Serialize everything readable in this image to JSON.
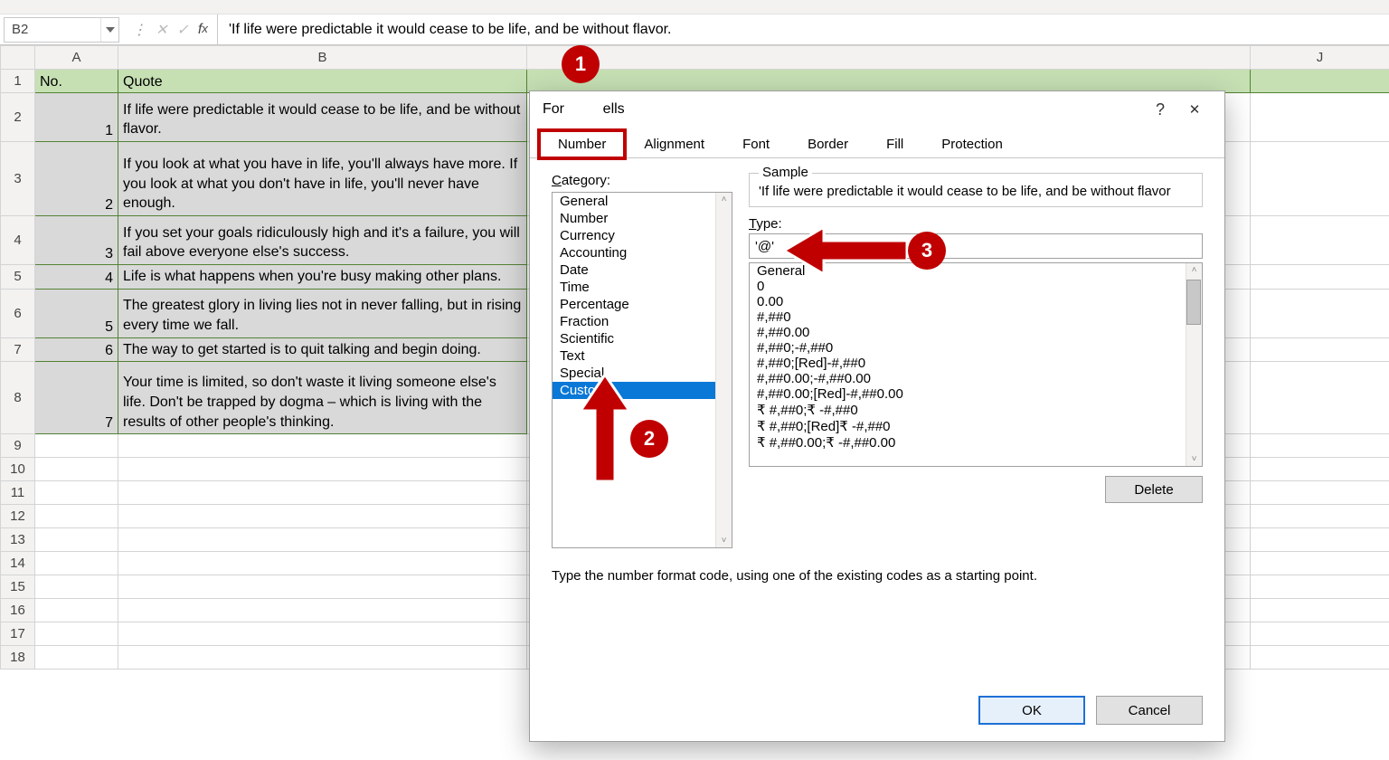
{
  "formula_bar": {
    "cell_ref": "B2",
    "formula": "'If life were predictable it would cease to be life, and be without flavor."
  },
  "columns": [
    "A",
    "B",
    "J"
  ],
  "rows": [
    {
      "n": 1,
      "a": "No.",
      "b": "Quote",
      "header": true
    },
    {
      "n": 2,
      "a": "1",
      "b": "If life were predictable it would cease to be life, and be without flavor."
    },
    {
      "n": 3,
      "a": "2",
      "b": "If you look at what you have in life, you'll always have more. If you look at what you don't have in life, you'll never have enough."
    },
    {
      "n": 4,
      "a": "3",
      "b": "If you set your goals ridiculously high and it's a failure, you will fail above everyone else's success."
    },
    {
      "n": 5,
      "a": "4",
      "b": "Life is what happens when you're busy making other plans."
    },
    {
      "n": 6,
      "a": "5",
      "b": "The greatest glory in living lies not in never falling, but in rising every time we fall."
    },
    {
      "n": 7,
      "a": "6",
      "b": "The way to get started is to quit talking and begin doing."
    },
    {
      "n": 8,
      "a": "7",
      "b": "Your time is limited, so don't waste it living someone else's life. Don't be trapped by dogma – which is living with the results of other people's thinking."
    },
    {
      "n": 9,
      "a": "",
      "b": ""
    },
    {
      "n": 10,
      "a": "",
      "b": ""
    },
    {
      "n": 11,
      "a": "",
      "b": ""
    },
    {
      "n": 12,
      "a": "",
      "b": ""
    },
    {
      "n": 13,
      "a": "",
      "b": ""
    },
    {
      "n": 14,
      "a": "",
      "b": ""
    },
    {
      "n": 15,
      "a": "",
      "b": ""
    },
    {
      "n": 16,
      "a": "",
      "b": ""
    },
    {
      "n": 17,
      "a": "",
      "b": ""
    },
    {
      "n": 18,
      "a": "",
      "b": ""
    }
  ],
  "dialog": {
    "title_prefix": "For",
    "title_suffix": "ells",
    "tabs": [
      "Number",
      "Alignment",
      "Font",
      "Border",
      "Fill",
      "Protection"
    ],
    "category_label": "Category:",
    "categories": [
      "General",
      "Number",
      "Currency",
      "Accounting",
      "Date",
      "Time",
      "Percentage",
      "Fraction",
      "Scientific",
      "Text",
      "Special",
      "Custom"
    ],
    "selected_category": "Custom",
    "sample_label": "Sample",
    "sample_value": "'If life were predictable it would cease to be life, and be without flavor",
    "type_label": "Type:",
    "type_value": "'@'",
    "type_options": [
      "General",
      "0",
      "0.00",
      "#,##0",
      "#,##0.00",
      "#,##0;-#,##0",
      "#,##0;[Red]-#,##0",
      "#,##0.00;-#,##0.00",
      "#,##0.00;[Red]-#,##0.00",
      "₹ #,##0;₹ -#,##0",
      "₹ #,##0;[Red]₹ -#,##0",
      "₹ #,##0.00;₹ -#,##0.00"
    ],
    "delete_label": "Delete",
    "hint": "Type the number format code, using one of the existing codes as a starting point.",
    "ok_label": "OK",
    "cancel_label": "Cancel"
  },
  "callouts": {
    "c1": "1",
    "c2": "2",
    "c3": "3"
  }
}
